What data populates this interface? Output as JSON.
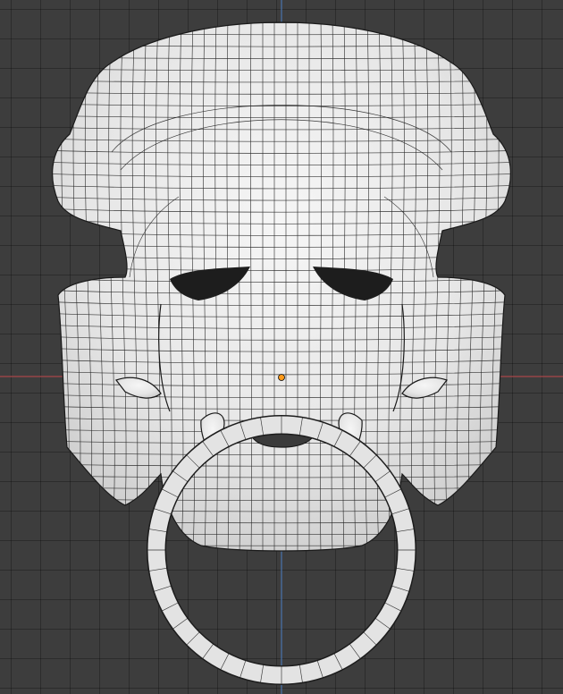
{
  "viewport": {
    "mode": "3d-viewport-wireframe-overlay",
    "object": "door-knocker-lion-mask",
    "colors": {
      "background": "#3d3d3d",
      "grid_line": "#2f2f2f",
      "x_axis": "#a8454a",
      "y_axis": "#4a74ad",
      "mesh_surface": "#ededed",
      "wire": "#232323",
      "origin_dot": "#ff9a1a"
    }
  }
}
